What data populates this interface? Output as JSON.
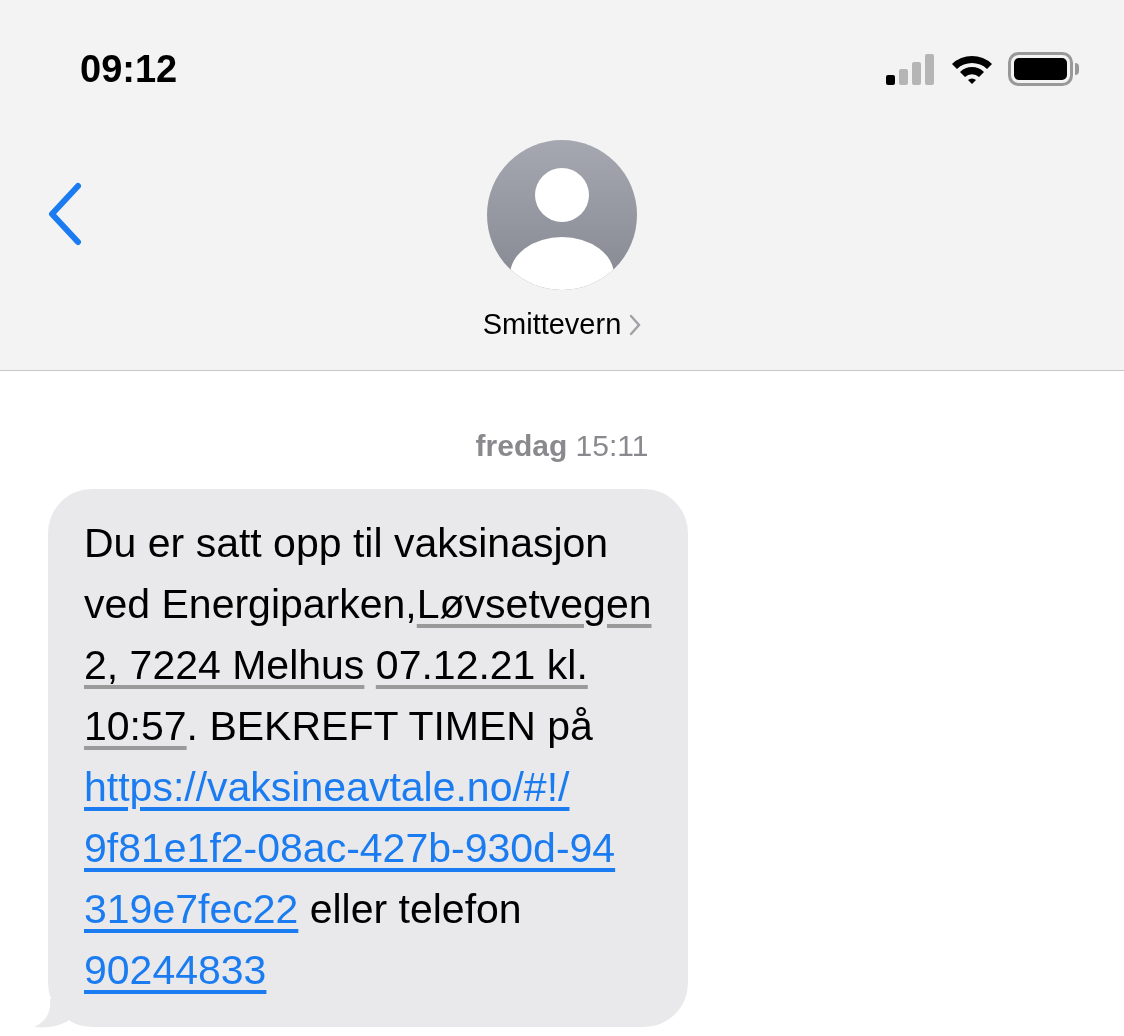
{
  "status_bar": {
    "time": "09:12"
  },
  "contact": {
    "name": "Smittevern"
  },
  "timestamp": "**fredag** 15:11",
  "message": {
    "lines": [
      [
        {
          "kind": "text",
          "text": "Du er satt opp til vaksinasjon"
        }
      ],
      [
        {
          "kind": "text",
          "text": "ved Energiparken,"
        },
        {
          "kind": "address",
          "text": "Løvsetvegen"
        }
      ],
      [
        {
          "kind": "address",
          "text": "2, 7224 Melhus"
        },
        {
          "kind": "date",
          "text": "07.12.21 kl."
        }
      ],
      [
        {
          "kind": "date",
          "text": "10:57"
        },
        {
          "kind": "text",
          "text": ". BEKREFT TIMEN på"
        }
      ],
      [
        {
          "kind": "url",
          "text": "https://vaksineavtale.no/#!/"
        }
      ],
      [
        {
          "kind": "url",
          "text": "9f81e1f2-08ac-427b-930d-94"
        }
      ],
      [
        {
          "kind": "url",
          "text": "319e7fec22"
        },
        {
          "kind": "text",
          "text": " eller telefon"
        }
      ],
      [
        {
          "kind": "phone",
          "text": "90244833"
        }
      ]
    ]
  }
}
